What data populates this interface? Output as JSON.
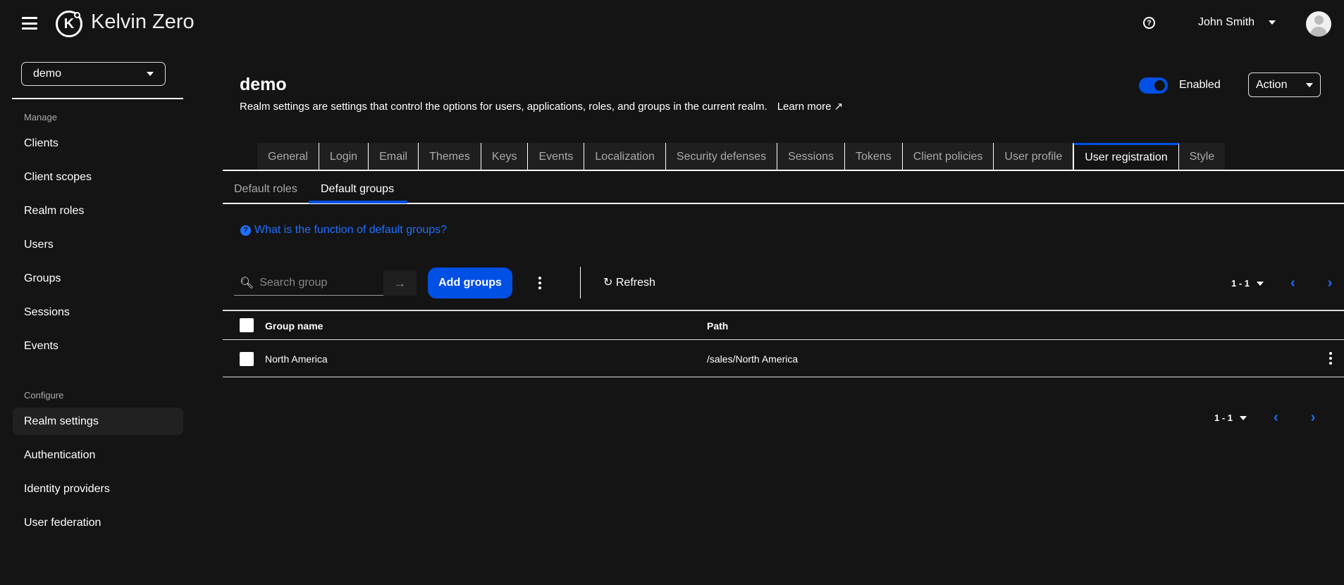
{
  "header": {
    "brand": "Kelvin Zero",
    "logo_letter": "K",
    "user_name": "John Smith"
  },
  "sidebar": {
    "realm": "demo",
    "manage_label": "Manage",
    "manage_items": [
      "Clients",
      "Client scopes",
      "Realm roles",
      "Users",
      "Groups",
      "Sessions",
      "Events"
    ],
    "configure_label": "Configure",
    "configure_items": [
      "Realm settings",
      "Authentication",
      "Identity providers",
      "User federation"
    ],
    "active": "Realm settings"
  },
  "page": {
    "title": "demo",
    "description": "Realm settings are settings that control the options for users, applications, roles, and groups in the current realm.",
    "learn_more": "Learn more",
    "enabled_label": "Enabled",
    "enabled": true,
    "action_label": "Action"
  },
  "tabs": [
    "General",
    "Login",
    "Email",
    "Themes",
    "Keys",
    "Events",
    "Localization",
    "Security defenses",
    "Sessions",
    "Tokens",
    "Client policies",
    "User profile",
    "User registration",
    "Style"
  ],
  "active_tab": "User registration",
  "subtabs": [
    "Default roles",
    "Default groups"
  ],
  "active_subtab": "Default groups",
  "help_link": "What is the function of default groups?",
  "toolbar": {
    "search_placeholder": "Search group",
    "add_label": "Add groups",
    "refresh_label": "Refresh",
    "pagination": "1 - 1"
  },
  "table": {
    "columns": [
      "Group name",
      "Path"
    ],
    "rows": [
      {
        "name": "North America",
        "path": "/sales/North America"
      }
    ]
  },
  "colors": {
    "accent": "#0050e6",
    "background": "#141414"
  }
}
